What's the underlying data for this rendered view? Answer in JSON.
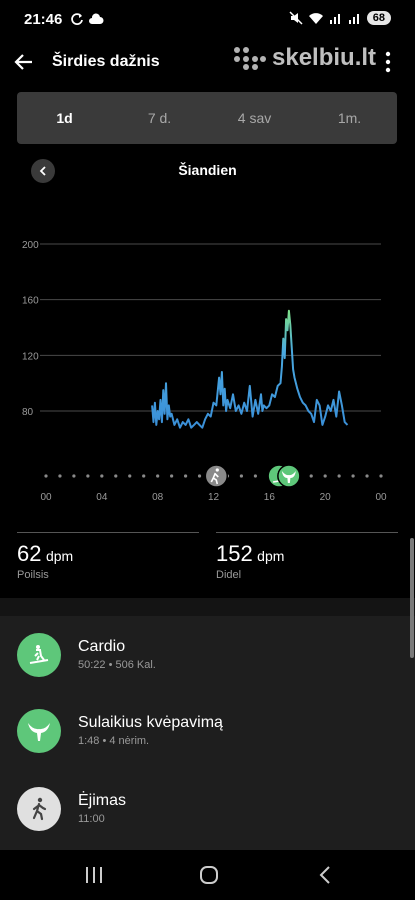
{
  "status": {
    "time": "21:46",
    "battery": "68"
  },
  "header": {
    "title": "Širdies dažnis",
    "watermark": "skelbiu.lt"
  },
  "tabs": [
    {
      "label": "1d",
      "active": true
    },
    {
      "label": "7 d.",
      "active": false
    },
    {
      "label": "4 sav",
      "active": false
    },
    {
      "label": "1m.",
      "active": false
    }
  ],
  "day": {
    "label": "Šiandien"
  },
  "chart_data": {
    "type": "line",
    "ylim": [
      60,
      210
    ],
    "y_ticks": [
      "200",
      "160",
      "120",
      "80"
    ],
    "y_tick_values": [
      200,
      160,
      120,
      80
    ],
    "xlim": [
      0,
      24
    ],
    "x_ticks": [
      "00",
      "04",
      "08",
      "12",
      "16",
      "20",
      "00"
    ],
    "x_tick_values": [
      0,
      4,
      8,
      12,
      16,
      20,
      24
    ],
    "series": [
      {
        "x": [
          7.6,
          7.7,
          7.8,
          7.9,
          8.0,
          8.1,
          8.2,
          8.3,
          8.4,
          8.5,
          8.6,
          8.7,
          8.8,
          8.9,
          9.0,
          9.2,
          9.4,
          9.6,
          9.8,
          10.0,
          10.2,
          10.4,
          10.6,
          10.8,
          11.0,
          11.2,
          11.4,
          11.6,
          11.8,
          12.0,
          12.2,
          12.4,
          12.5,
          12.6,
          12.7,
          12.8,
          12.9,
          13.0,
          13.2,
          13.4,
          13.6,
          13.8,
          14.0,
          14.2,
          14.4,
          14.6,
          14.8,
          15.0,
          15.2,
          15.4,
          15.5,
          15.6,
          15.8,
          16.0,
          16.2,
          16.4,
          16.6,
          16.8,
          16.9,
          17.0,
          17.1,
          17.2,
          17.3,
          17.4,
          17.5,
          17.6,
          17.7,
          17.8,
          18.0,
          18.2,
          18.4,
          18.6,
          18.8,
          19.0,
          19.2,
          19.4,
          19.6,
          19.8,
          20.0,
          20.2,
          20.4,
          20.6,
          20.8,
          21.0,
          21.2,
          21.4,
          21.6
        ],
        "y": [
          84,
          72,
          86,
          70,
          80,
          74,
          88,
          72,
          95,
          78,
          100,
          74,
          84,
          76,
          78,
          70,
          74,
          68,
          72,
          70,
          74,
          68,
          70,
          72,
          70,
          68,
          74,
          78,
          76,
          86,
          84,
          104,
          92,
          108,
          84,
          96,
          80,
          88,
          82,
          92,
          80,
          84,
          78,
          86,
          80,
          98,
          76,
          88,
          78,
          92,
          80,
          84,
          82,
          84,
          92,
          90,
          98,
          100,
          112,
          132,
          118,
          146,
          138,
          152,
          142,
          126,
          110,
          104,
          96,
          90,
          86,
          84,
          80,
          78,
          72,
          88,
          84,
          70,
          76,
          84,
          80,
          88,
          76,
          94,
          84,
          72,
          70
        ]
      }
    ],
    "markers": [
      {
        "x": 12.2,
        "icon": "walk-icon",
        "color": "#8a8a8a"
      },
      {
        "x": 16.7,
        "icon": "treadmill-icon",
        "color": "#5ec77a"
      },
      {
        "x": 17.4,
        "icon": "whale-tail-icon",
        "color": "#5ec77a"
      }
    ]
  },
  "stats": {
    "rest": {
      "value": "62",
      "unit": "dpm",
      "label": "Poilsis"
    },
    "max": {
      "value": "152",
      "unit": "dpm",
      "label": "Didel"
    }
  },
  "activities": [
    {
      "title": "Cardio",
      "sub": "50:22 • 506 Kal.",
      "icon": "treadmill-icon",
      "color": "#5ec77a"
    },
    {
      "title": "Sulaikius kvėpavimą",
      "sub": "1:48 • 4 nėrim.",
      "icon": "whale-tail-icon",
      "color": "#5ec77a"
    },
    {
      "title": "Ėjimas",
      "sub": "11:00",
      "icon": "walk-icon",
      "color": "#e0e0e0"
    }
  ]
}
